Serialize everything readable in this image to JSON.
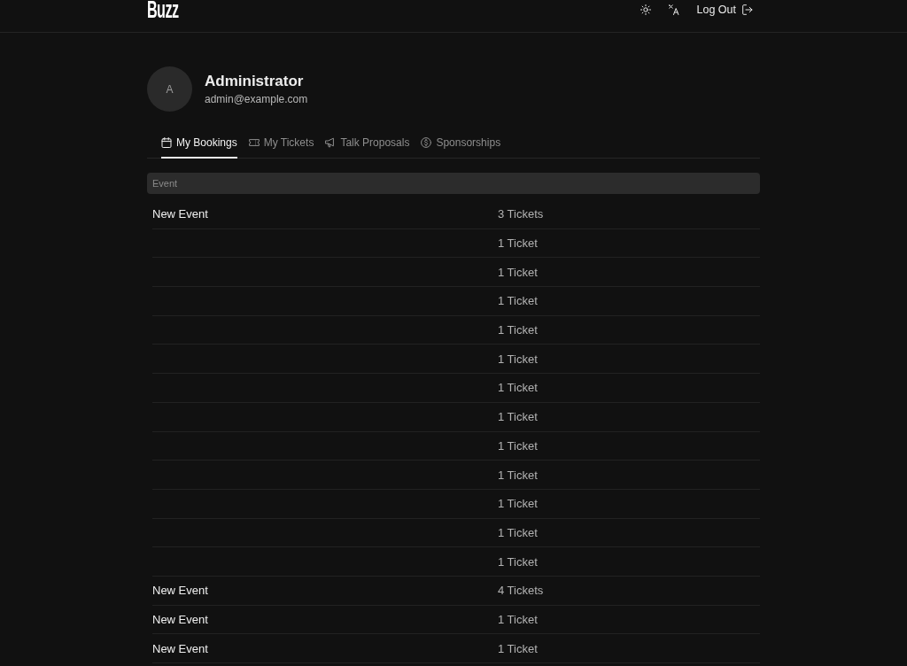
{
  "header": {
    "logo": "Buzz",
    "logout": "Log Out"
  },
  "profile": {
    "avatar_initial": "A",
    "name": "Administrator",
    "email": "admin@example.com"
  },
  "tabs": [
    {
      "label": "My Bookings",
      "selected": true
    },
    {
      "label": "My Tickets",
      "selected": false
    },
    {
      "label": "Talk Proposals",
      "selected": false
    },
    {
      "label": "Sponsorships",
      "selected": false
    }
  ],
  "table": {
    "columns": [
      "Event"
    ],
    "rows": [
      {
        "event": "New Event",
        "column_2": "3 Tickets"
      },
      {
        "column_2": "1 Ticket"
      },
      {
        "column_2": "1 Ticket"
      },
      {
        "column_2": "1 Ticket"
      },
      {
        "column_2": "1 Ticket"
      },
      {
        "column_2": "1 Ticket"
      },
      {
        "column_2": "1 Ticket"
      },
      {
        "column_2": "1 Ticket"
      },
      {
        "column_2": "1 Ticket"
      },
      {
        "column_2": "1 Ticket"
      },
      {
        "column_2": "1 Ticket"
      },
      {
        "column_2": "1 Ticket"
      },
      {
        "column_2": "1 Ticket"
      },
      {
        "event": "New Event",
        "column_2": "4 Tickets"
      },
      {
        "event": "New Event",
        "column_2": "1 Ticket"
      },
      {
        "event": "New Event",
        "column_2": "1 Ticket"
      }
    ]
  }
}
